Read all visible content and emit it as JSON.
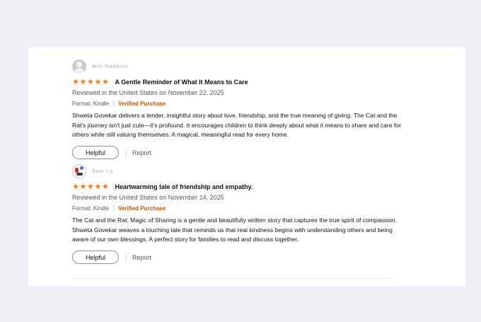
{
  "reviews": [
    {
      "profile_name": "Will Hawkins",
      "avatar_icon": "default-profile-icon",
      "rating": 5,
      "title": "A Gentle Reminder of What It Means to Care",
      "reviewed_line": "Reviewed in the United States on November 22, 2025",
      "format": "Format: Kindle",
      "verified": "Verified Purchase",
      "body": "Shweta Govekar delivers a tender, insightful story about love, friendship, and the true meaning of giving. The Cat and the Rat's journey isn't just cute—it's profound. It encourages children to think deeply about what it means to share and care for others while still valuing themselves. A magical, meaningful read for every home.",
      "helpful_label": "Helpful",
      "report_label": "Report"
    },
    {
      "profile_name": "Sam Lu",
      "avatar_icon": "photo-avatar-icon",
      "rating": 5,
      "title": "Heartwarming tale of friendship and empathy.",
      "reviewed_line": "Reviewed in the United States on November 14, 2025",
      "format": "Format: Kindle",
      "verified": "Verified Purchase",
      "body": "The Cat and the Rat: Magic of Sharing is a gentle and beautifully written story that captures the true spirit of compassion. Shweta Govekar weaves a touching tale that reminds us that real kindness begins with understanding others and being aware of our own blessings. A perfect story for families to read and discuss together.",
      "helpful_label": "Helpful",
      "report_label": "Report"
    }
  ],
  "colors": {
    "star": "#f37b1d",
    "verified": "#c45500",
    "page_bg": "#eef0f6"
  }
}
